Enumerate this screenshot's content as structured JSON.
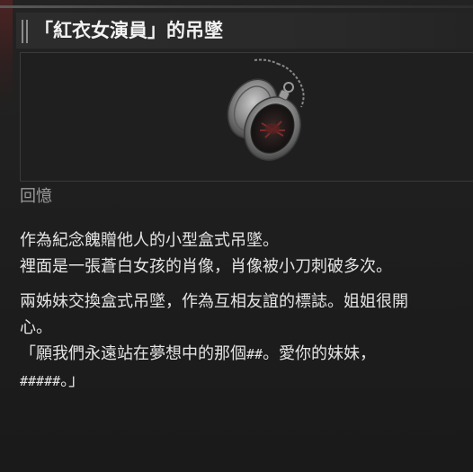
{
  "item": {
    "title": "「紅衣女演員」的吊墜",
    "category": "回憶",
    "description_block1": [
      "作為紀念餽贈他人的小型盒式吊墜。",
      "裡面是一張蒼白女孩的肖像，肖像被小刀刺破多次。"
    ],
    "description_block2": [
      "兩姊妹交換盒式吊墜，作為互相友誼的標誌。姐姐很開",
      "心。"
    ],
    "quote_line1_a": "「願我們永遠站在夢想中的那個",
    "quote_line1_hash": "##",
    "quote_line1_b": "。愛你的妹妹，",
    "quote_line2_hash": "#####",
    "quote_line2_b": "。」",
    "image_icon": "pocket-watch-locket"
  }
}
